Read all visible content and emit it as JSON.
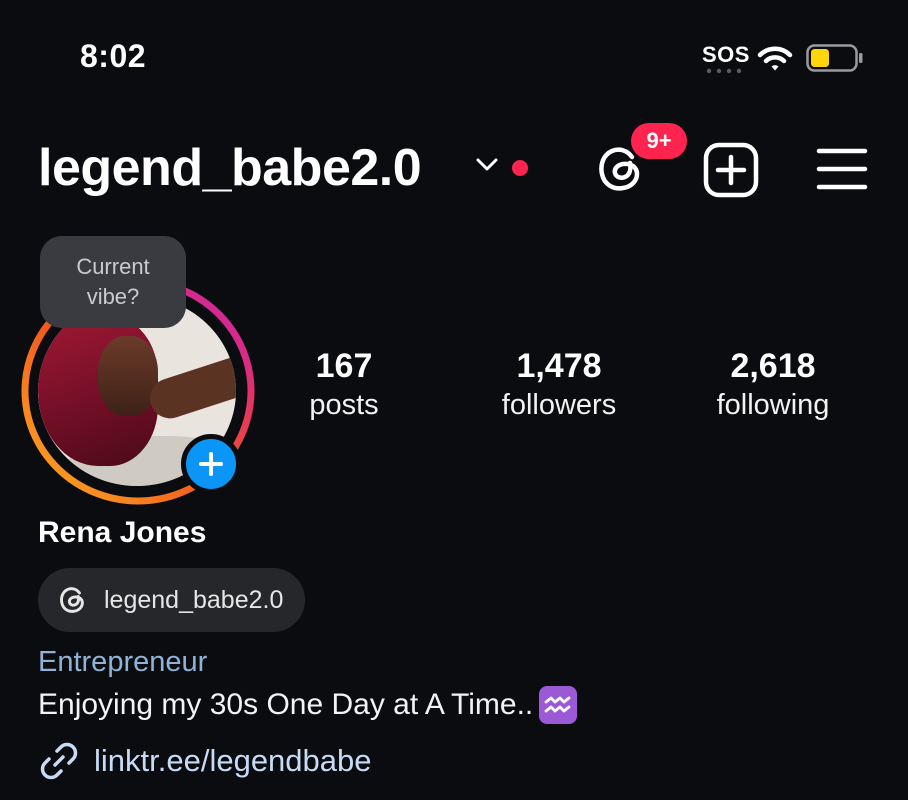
{
  "status_bar": {
    "time": "8:02",
    "carrier": "SOS"
  },
  "header": {
    "username": "legend_babe2.0",
    "notification_badge": "9+"
  },
  "profile": {
    "note_prompt": "Current\nvibe?",
    "stats": [
      {
        "value": "167",
        "label": "posts"
      },
      {
        "value": "1,478",
        "label": "followers"
      },
      {
        "value": "2,618",
        "label": "following"
      }
    ],
    "name": "Rena Jones",
    "threads_handle": "legend_babe2.0",
    "category": "Entrepreneur",
    "bio": "Enjoying my 30s One Day at A Time..",
    "link": "linktr.ee/legendbabe"
  },
  "colors": {
    "background": "#0b0c10",
    "badge_red": "#ff2450",
    "add_blue": "#0b95f6",
    "category_blue": "#8fb3d6",
    "link_blue": "#c7dcf4"
  }
}
